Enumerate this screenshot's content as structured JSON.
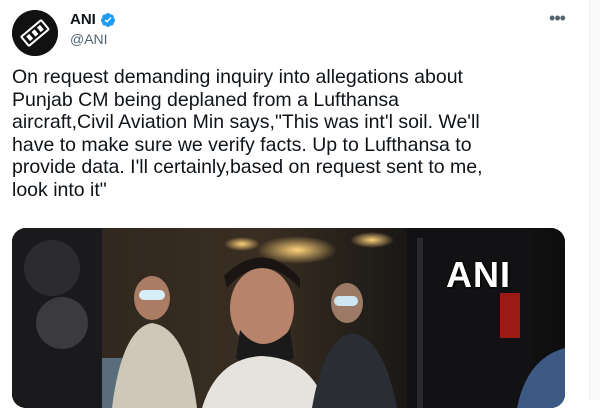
{
  "tweet": {
    "author": {
      "name": "ANI",
      "handle": "@ANI",
      "verified": true,
      "avatar_icon": "ani-logo-avatar"
    },
    "more_icon": "more-options-icon",
    "text": "On request demanding inquiry into allegations about\nPunjab CM being deplaned from a Lufthansa\naircraft,Civil Aviation Min says,\"This was int'l soil. We'll\nhave to make sure we verify facts. Up to Lufthansa to\nprovide data. I'll certainly,based on request sent to me,\nlook into it\"",
    "media": {
      "watermark": "ANI",
      "description_icon": "video-frame-image"
    }
  },
  "colors": {
    "verified_blue": "#1d9bf0",
    "text": "#0f1419",
    "secondary": "#536471"
  }
}
